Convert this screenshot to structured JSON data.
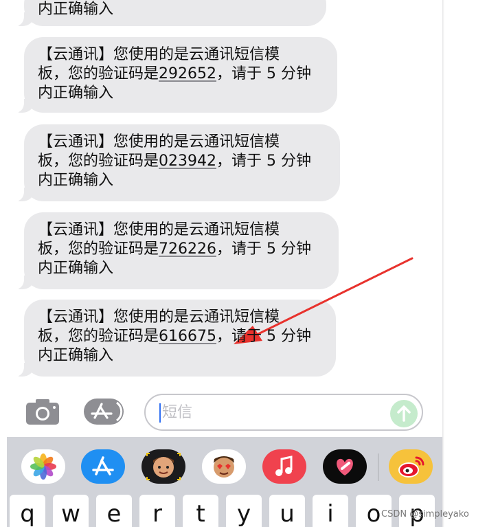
{
  "messages": [
    {
      "line1": "",
      "line2": "",
      "line3_prefix": "内正确输入"
    },
    {
      "line1": "【云通讯】您使用的是云通讯短信模",
      "line2_pre": "板，您的验证码是",
      "code": "292652",
      "line2_post": "，请于 5 分钟",
      "line3": "内正确输入"
    },
    {
      "line1": "【云通讯】您使用的是云通讯短信模",
      "line2_pre": "板，您的验证码是",
      "code": "023942",
      "line2_post": "，请于 5 分钟",
      "line3": "内正确输入"
    },
    {
      "line1": "【云通讯】您使用的是云通讯短信模",
      "line2_pre": "板，您的验证码是",
      "code": "726226",
      "line2_post": "，请于 5 分钟",
      "line3": "内正确输入"
    },
    {
      "line1": "【云通讯】您使用的是云通讯短信模",
      "line2_pre": "板，您的验证码是",
      "code": "616675",
      "line2_post": "，请于 5 分钟",
      "line3": "内正确输入"
    }
  ],
  "input": {
    "placeholder": "短信"
  },
  "icons": {
    "camera": "camera-icon",
    "appstore": "app-store-icon",
    "send": "send-arrow-icon"
  },
  "apps": [
    "photos-icon",
    "app-store-icon",
    "memoji-icon",
    "animoji-stickers-icon",
    "music-icon",
    "heart-digital-touch-icon",
    "weibo-icon"
  ],
  "keyboard": {
    "keys": [
      "q",
      "w",
      "e",
      "r",
      "t",
      "y",
      "u",
      "i",
      "o",
      "p"
    ]
  },
  "colors": {
    "bubble": "#e9e9eb",
    "accent": "#e8322d",
    "send": "#c5ebcc",
    "tray": "#d1d3d9"
  },
  "watermark": "CSDN @simpleyako"
}
